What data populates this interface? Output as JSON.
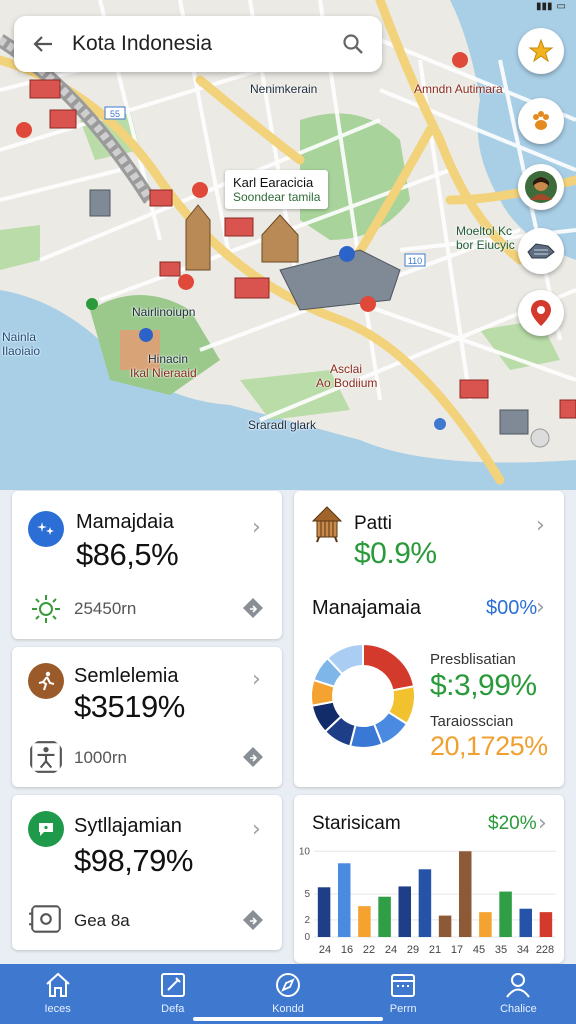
{
  "search": {
    "title": "Kota Indonesia"
  },
  "map": {
    "labels": [
      "Nenimkerain",
      "Amndn Autimara",
      "Nairlinoiupn",
      "Hinacin",
      "Ikal Nieraaid",
      "Nainla",
      "Ilaoiaio",
      "Asclai",
      "Ao Bodiium",
      "Sraradl glark",
      "Moeltol Kc",
      "bor Eiucyic"
    ],
    "callout": {
      "line1": "Karl Earacicia",
      "line2": "Soondear tamila"
    },
    "road_badges": [
      "55",
      "110"
    ]
  },
  "cards": {
    "c1": {
      "title": "Mamajdaia",
      "value": "$86,5%",
      "sub": "25450rn"
    },
    "c2": {
      "title": "Semlelemia",
      "value": "$3519%",
      "sub": "1000rn"
    },
    "c3": {
      "title": "Sytllajamian",
      "value": "$98,79%",
      "sub": "Gea 8a"
    },
    "c4": {
      "title": "Patti",
      "value": "$0.9%"
    },
    "c5": {
      "title": "Manajamaia",
      "value": "$00%",
      "stat1_label": "Presblisatian",
      "stat1_value": "$:3,99%",
      "stat2_label": "Taraiosscian",
      "stat2_value": "20,1725%"
    },
    "c6": {
      "title": "Starisicam",
      "value": "$20%"
    }
  },
  "colors": {
    "accent": "#3f79cf",
    "green": "#2a9a3a",
    "orange": "#f0a030",
    "red": "#d33a2c"
  },
  "chart_data": [
    {
      "type": "pie",
      "slices": [
        {
          "value": 22,
          "color": "#d33a2c"
        },
        {
          "value": 12,
          "color": "#f2c12e"
        },
        {
          "value": 10,
          "color": "#4a8ae0"
        },
        {
          "value": 10,
          "color": "#3a78d6"
        },
        {
          "value": 9,
          "color": "#1e3f87"
        },
        {
          "value": 9,
          "color": "#122c6a"
        },
        {
          "value": 8,
          "color": "#f4a330"
        },
        {
          "value": 8,
          "color": "#7fb6ea"
        },
        {
          "value": 12,
          "color": "#a9cdf3"
        }
      ]
    },
    {
      "type": "bar",
      "categories": [
        "24",
        "16",
        "22",
        "24",
        "29",
        "21",
        "17",
        "45",
        "35",
        "34",
        "228"
      ],
      "values": [
        5.8,
        8.6,
        3.6,
        4.7,
        5.9,
        7.9,
        2.5,
        10,
        2.9,
        5.3,
        3.3,
        2.9
      ],
      "bar_colors": [
        "#1e3f87",
        "#4a8ae0",
        "#f4a330",
        "#2f9e44",
        "#1e3f87",
        "#2553a8",
        "#8c5a36",
        "#8c5a36",
        "#f4a330",
        "#2f9e44",
        "#2553a8",
        "#d33a2c"
      ],
      "y_ticks": [
        "10",
        "5",
        "2",
        "0"
      ],
      "ylim": [
        0,
        10.5
      ]
    }
  ],
  "nav": [
    {
      "label": "Ieces",
      "icon": "home-icon"
    },
    {
      "label": "Defa",
      "icon": "edit-icon"
    },
    {
      "label": "Kondd",
      "icon": "compass-icon"
    },
    {
      "label": "Perrn",
      "icon": "calendar-icon"
    },
    {
      "label": "Chalice",
      "icon": "profile-icon"
    }
  ]
}
